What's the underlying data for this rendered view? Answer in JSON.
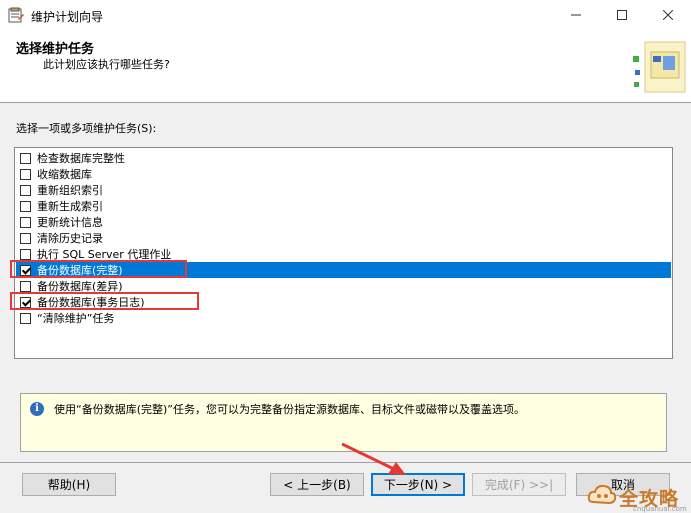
{
  "window": {
    "title": "维护计划向导"
  },
  "header": {
    "title": "选择维护任务",
    "subtitle": "此计划应该执行哪些任务?"
  },
  "task_prompt": "选择一项或多项维护任务(S):",
  "tasks": [
    {
      "label": "检查数据库完整性",
      "checked": false,
      "selected": false
    },
    {
      "label": "收缩数据库",
      "checked": false,
      "selected": false
    },
    {
      "label": "重新组织索引",
      "checked": false,
      "selected": false
    },
    {
      "label": "重新生成索引",
      "checked": false,
      "selected": false
    },
    {
      "label": "更新统计信息",
      "checked": false,
      "selected": false
    },
    {
      "label": "清除历史记录",
      "checked": false,
      "selected": false
    },
    {
      "label": "执行 SQL Server 代理作业",
      "checked": false,
      "selected": false
    },
    {
      "label": "备份数据库(完整)",
      "checked": true,
      "selected": true
    },
    {
      "label": "备份数据库(差异)",
      "checked": false,
      "selected": false
    },
    {
      "label": "备份数据库(事务日志)",
      "checked": true,
      "selected": false
    },
    {
      "label": "“清除维护”任务",
      "checked": false,
      "selected": false
    }
  ],
  "info": {
    "icon": "info-icon",
    "text": "使用“备份数据库(完整)”任务，您可以为完整备份指定源数据库、目标文件或磁带以及覆盖选项。"
  },
  "buttons": {
    "help": "帮助(H)",
    "back": "< 上一步(B)",
    "next": "下一步(N) >",
    "finish": "完成(F) >>|",
    "cancel": "取消"
  },
  "watermark": {
    "text": "全攻略",
    "sub": "cnquanuai.com"
  },
  "colors": {
    "selection": "#0078d7",
    "highlight_box": "#e53935",
    "info_bg": "#ffffe1"
  }
}
